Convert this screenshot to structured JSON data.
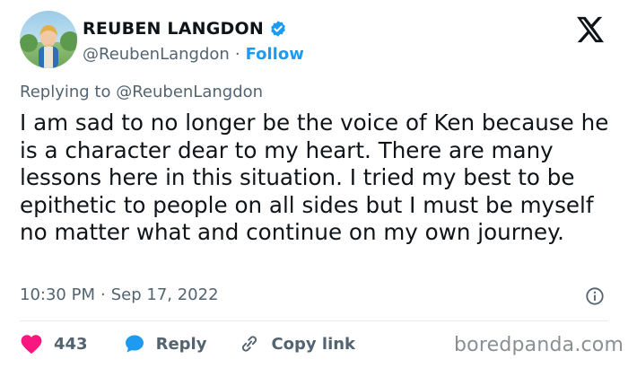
{
  "author": {
    "display_name": "REUBEN LANGDON",
    "handle": "@ReubenLangdon",
    "separator": "·",
    "follow_label": "Follow",
    "verified_icon": "verified-badge-icon"
  },
  "reply_context": {
    "prefix": "Replying to",
    "mention": "@ReubenLangdon"
  },
  "tweet": {
    "text": "I am sad to no longer be the voice of Ken because he is a character dear to my heart. There are many lessons here in this situation. I tried my best to be epithetic to people on all sides but I must be myself no matter what and continue on my own journey.",
    "time": "10:30 PM",
    "separator": "·",
    "date": "Sep 17, 2022"
  },
  "actions": {
    "like_count": "443",
    "reply_label": "Reply",
    "copy_label": "Copy link"
  },
  "icons": {
    "platform_logo": "x-logo-icon",
    "info": "info-icon",
    "like": "heart-icon",
    "reply": "speech-bubble-icon",
    "copy": "link-icon"
  },
  "colors": {
    "accent": "#1d9bf0",
    "like": "#f91880",
    "text": "#0f1419",
    "muted": "#536471"
  },
  "watermark": {
    "text": "boredpanda.com"
  }
}
